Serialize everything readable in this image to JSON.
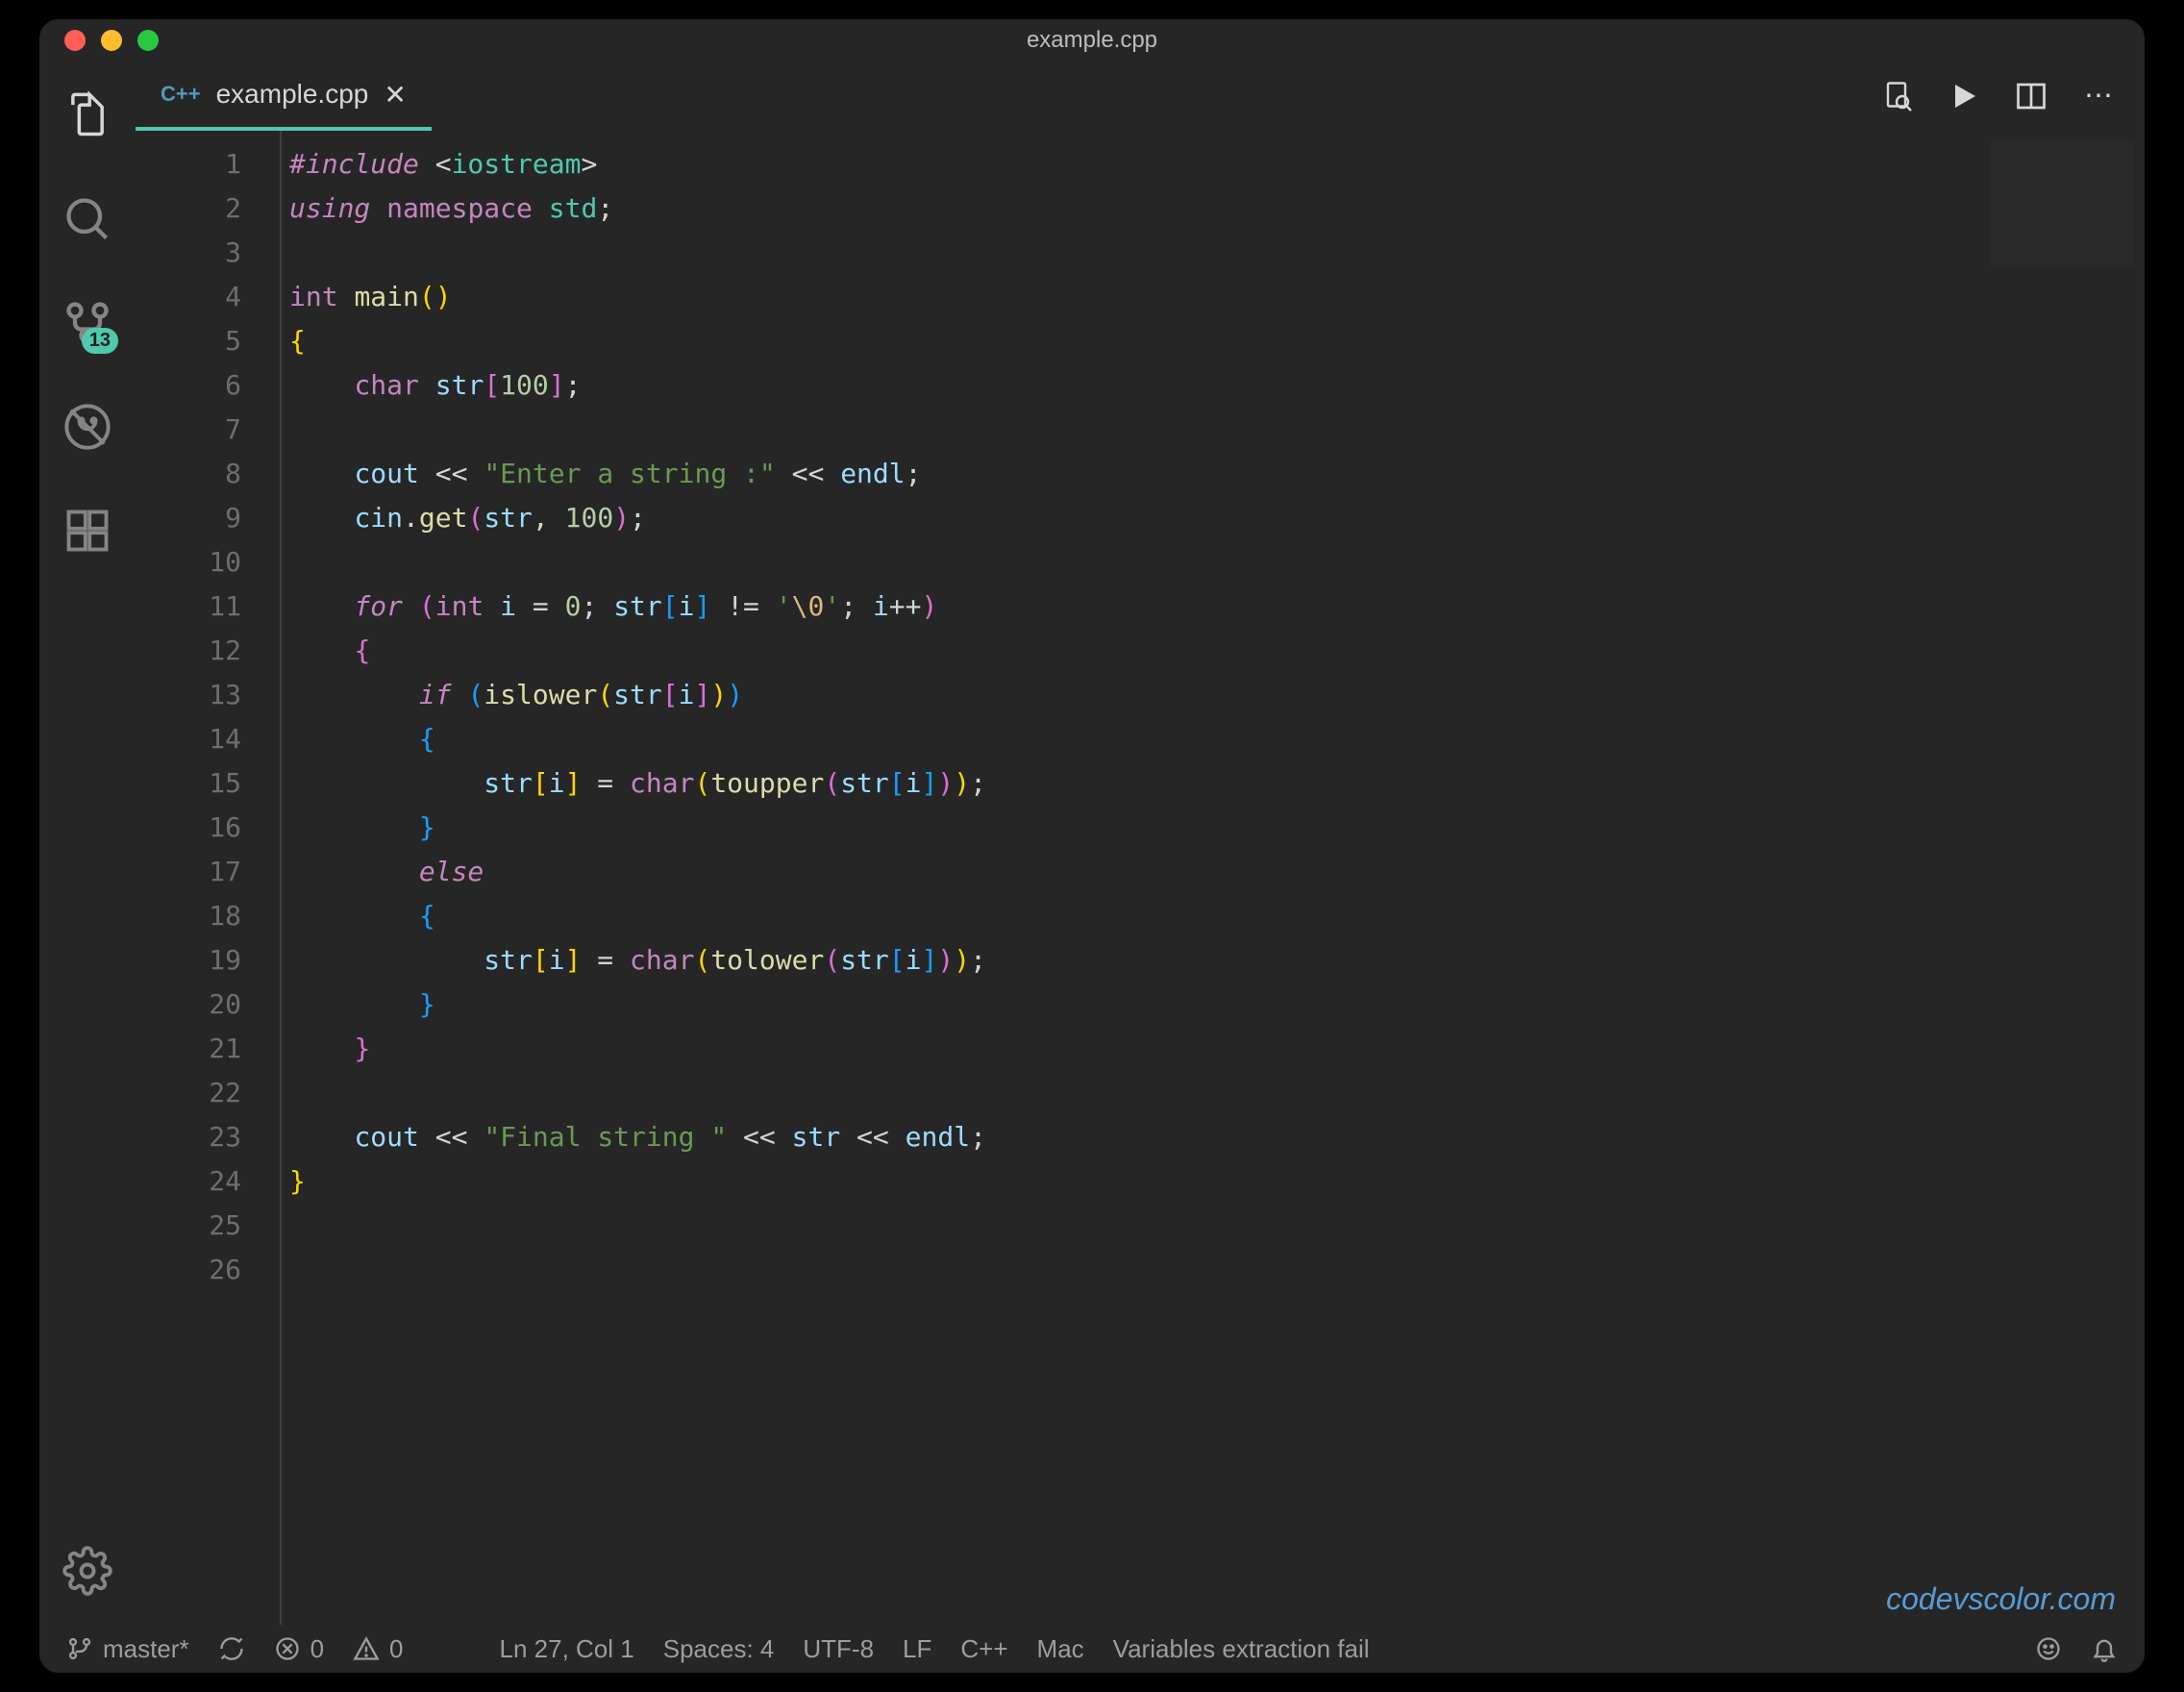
{
  "title": "example.cpp",
  "tab": {
    "language": "C++",
    "filename": "example.cpp"
  },
  "activitybar": {
    "scm_badge": "13"
  },
  "code_lines": [
    [
      [
        "pp",
        "#include "
      ],
      [
        "op",
        "<"
      ],
      [
        "sys",
        "iostream"
      ],
      [
        "op",
        ">"
      ]
    ],
    [
      [
        "pp",
        "using "
      ],
      [
        "ty",
        "namespace "
      ],
      [
        "ns",
        "std"
      ],
      [
        "punc",
        ";"
      ]
    ],
    [],
    [
      [
        "ty",
        "int "
      ],
      [
        "fn",
        "main"
      ],
      [
        "br",
        "()"
      ]
    ],
    [
      [
        "br",
        "{"
      ]
    ],
    [
      [
        "id",
        "    "
      ],
      [
        "ty",
        "char "
      ],
      [
        "var",
        "str"
      ],
      [
        "br2",
        "["
      ],
      [
        "num",
        "100"
      ],
      [
        "br2",
        "]"
      ],
      [
        "punc",
        ";"
      ]
    ],
    [],
    [
      [
        "id",
        "    "
      ],
      [
        "var",
        "cout"
      ],
      [
        "op",
        " << "
      ],
      [
        "str",
        "\"Enter a string :\""
      ],
      [
        "op",
        " << "
      ],
      [
        "var",
        "endl"
      ],
      [
        "punc",
        ";"
      ]
    ],
    [
      [
        "id",
        "    "
      ],
      [
        "var",
        "cin"
      ],
      [
        "punc",
        "."
      ],
      [
        "fn",
        "get"
      ],
      [
        "br2",
        "("
      ],
      [
        "var",
        "str"
      ],
      [
        "punc",
        ", "
      ],
      [
        "num",
        "100"
      ],
      [
        "br2",
        ")"
      ],
      [
        "punc",
        ";"
      ]
    ],
    [],
    [
      [
        "id",
        "    "
      ],
      [
        "kw",
        "for "
      ],
      [
        "br2",
        "("
      ],
      [
        "ty",
        "int "
      ],
      [
        "var",
        "i"
      ],
      [
        "op",
        " = "
      ],
      [
        "num",
        "0"
      ],
      [
        "punc",
        "; "
      ],
      [
        "var",
        "str"
      ],
      [
        "br3",
        "["
      ],
      [
        "var",
        "i"
      ],
      [
        "br3",
        "]"
      ],
      [
        "op",
        " != "
      ],
      [
        "str",
        "'"
      ],
      [
        "esc",
        "\\0"
      ],
      [
        "str",
        "'"
      ],
      [
        "punc",
        "; "
      ],
      [
        "var",
        "i"
      ],
      [
        "op",
        "++"
      ],
      [
        "br2",
        ")"
      ]
    ],
    [
      [
        "id",
        "    "
      ],
      [
        "br2",
        "{"
      ]
    ],
    [
      [
        "id",
        "        "
      ],
      [
        "kw",
        "if "
      ],
      [
        "br3",
        "("
      ],
      [
        "fn",
        "islower"
      ],
      [
        "br",
        "("
      ],
      [
        "var",
        "str"
      ],
      [
        "br2",
        "["
      ],
      [
        "var",
        "i"
      ],
      [
        "br2",
        "]"
      ],
      [
        "br",
        ")"
      ],
      [
        "br3",
        ")"
      ]
    ],
    [
      [
        "id",
        "        "
      ],
      [
        "br3",
        "{"
      ]
    ],
    [
      [
        "id",
        "            "
      ],
      [
        "var",
        "str"
      ],
      [
        "br",
        "["
      ],
      [
        "var",
        "i"
      ],
      [
        "br",
        "]"
      ],
      [
        "op",
        " = "
      ],
      [
        "ty",
        "char"
      ],
      [
        "br",
        "("
      ],
      [
        "fn",
        "toupper"
      ],
      [
        "br2",
        "("
      ],
      [
        "var",
        "str"
      ],
      [
        "br3",
        "["
      ],
      [
        "var",
        "i"
      ],
      [
        "br3",
        "]"
      ],
      [
        "br2",
        ")"
      ],
      [
        "br",
        ")"
      ],
      [
        "punc",
        ";"
      ]
    ],
    [
      [
        "id",
        "        "
      ],
      [
        "br3",
        "}"
      ]
    ],
    [
      [
        "id",
        "        "
      ],
      [
        "kw",
        "else"
      ]
    ],
    [
      [
        "id",
        "        "
      ],
      [
        "br3",
        "{"
      ]
    ],
    [
      [
        "id",
        "            "
      ],
      [
        "var",
        "str"
      ],
      [
        "br",
        "["
      ],
      [
        "var",
        "i"
      ],
      [
        "br",
        "]"
      ],
      [
        "op",
        " = "
      ],
      [
        "ty",
        "char"
      ],
      [
        "br",
        "("
      ],
      [
        "fn",
        "tolower"
      ],
      [
        "br2",
        "("
      ],
      [
        "var",
        "str"
      ],
      [
        "br3",
        "["
      ],
      [
        "var",
        "i"
      ],
      [
        "br3",
        "]"
      ],
      [
        "br2",
        ")"
      ],
      [
        "br",
        ")"
      ],
      [
        "punc",
        ";"
      ]
    ],
    [
      [
        "id",
        "        "
      ],
      [
        "br3",
        "}"
      ]
    ],
    [
      [
        "id",
        "    "
      ],
      [
        "br2",
        "}"
      ]
    ],
    [],
    [
      [
        "id",
        "    "
      ],
      [
        "var",
        "cout"
      ],
      [
        "op",
        " << "
      ],
      [
        "str",
        "\"Final string \""
      ],
      [
        "op",
        " << "
      ],
      [
        "var",
        "str"
      ],
      [
        "op",
        " << "
      ],
      [
        "var",
        "endl"
      ],
      [
        "punc",
        ";"
      ]
    ],
    [
      [
        "br",
        "}"
      ]
    ],
    [],
    []
  ],
  "statusbar": {
    "branch": "master*",
    "errors": "0",
    "warnings": "0",
    "cursor": "Ln 27, Col 1",
    "spaces": "Spaces: 4",
    "encoding": "UTF-8",
    "eol": "LF",
    "language": "C++",
    "os": "Mac",
    "extra": "Variables extraction fail"
  },
  "watermark": "codevscolor.com"
}
